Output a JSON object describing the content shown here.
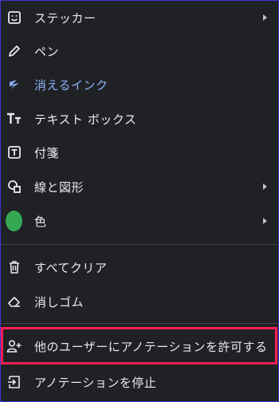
{
  "menu": {
    "items": [
      {
        "label": "ステッカー",
        "icon": "sticker-icon",
        "has_submenu": true
      },
      {
        "label": "ペン",
        "icon": "pen-icon",
        "has_submenu": false
      },
      {
        "label": "消えるインク",
        "icon": "laser-icon",
        "has_submenu": false,
        "accent": "#8ab4f8"
      },
      {
        "label": "テキスト ボックス",
        "icon": "text-icon",
        "has_submenu": false
      },
      {
        "label": "付箋",
        "icon": "sticky-note-icon",
        "has_submenu": false
      },
      {
        "label": "線と図形",
        "icon": "shapes-icon",
        "has_submenu": true
      },
      {
        "label": "色",
        "icon": "color-dot-icon",
        "has_submenu": true,
        "color": "#34a853"
      },
      {
        "label": "すべてクリア",
        "icon": "trash-icon",
        "has_submenu": false
      },
      {
        "label": "消しゴム",
        "icon": "eraser-icon",
        "has_submenu": false
      },
      {
        "label": "他のユーザーにアノテーションを許可する",
        "icon": "add-person-icon",
        "has_submenu": false,
        "highlighted": true
      },
      {
        "label": "アノテーションを停止",
        "icon": "exit-icon",
        "has_submenu": false
      }
    ]
  },
  "colors": {
    "background": "#202124",
    "text": "#e8eaed",
    "accent": "#8ab4f8",
    "highlight_border": "#ff1f56",
    "divider": "#3c4043"
  }
}
